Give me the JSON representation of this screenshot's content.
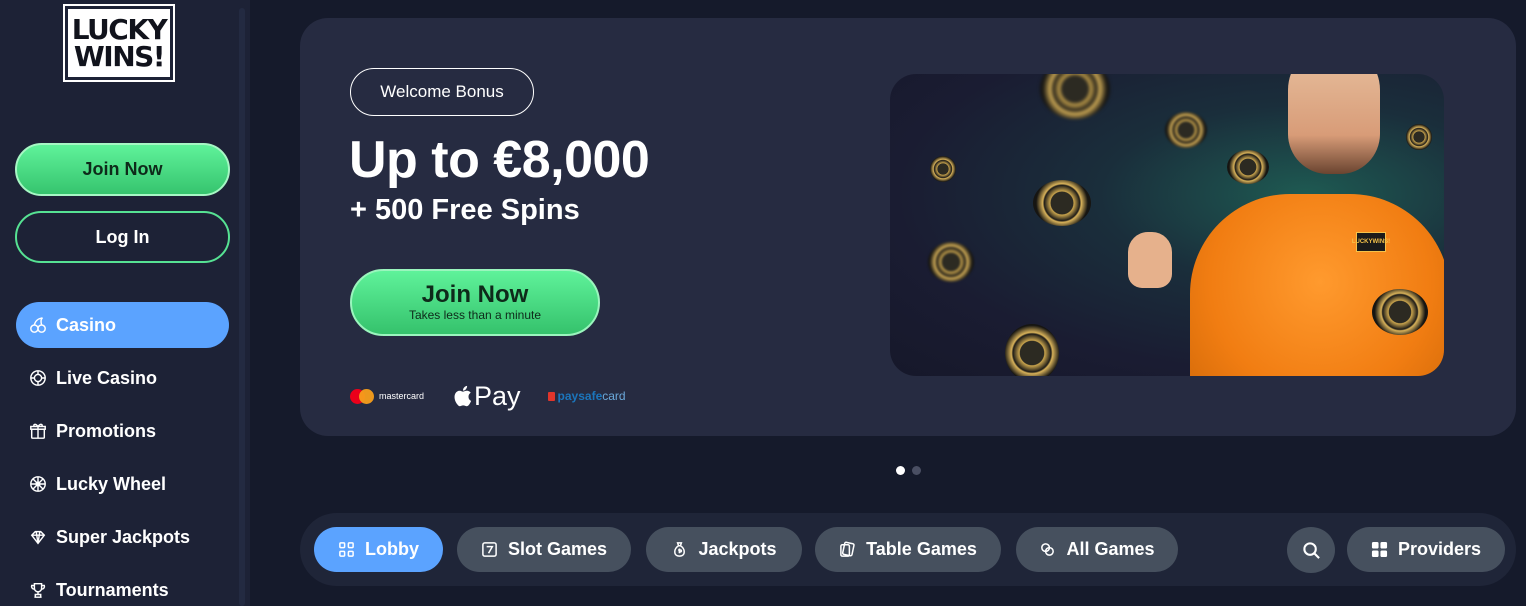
{
  "logo": {
    "line1": "LUCKY",
    "line2": "WINS!"
  },
  "auth": {
    "join_label": "Join Now",
    "login_label": "Log In"
  },
  "sidebar": {
    "items": [
      {
        "label": "Casino",
        "icon": "cherries-icon",
        "active": true
      },
      {
        "label": "Live Casino",
        "icon": "poker-chip-icon",
        "active": false
      },
      {
        "label": "Promotions",
        "icon": "gift-icon",
        "active": false
      },
      {
        "label": "Lucky Wheel",
        "icon": "wheel-icon",
        "active": false
      },
      {
        "label": "Super Jackpots",
        "icon": "diamond-icon",
        "active": false
      },
      {
        "label": "Tournaments",
        "icon": "trophy-icon",
        "active": false
      }
    ]
  },
  "banner": {
    "badge": "Welcome Bonus",
    "headline": "Up to €8,000",
    "subheadline": "+ 500 Free Spins",
    "cta_label": "Join Now",
    "cta_sublabel": "Takes less than a minute",
    "payments": {
      "mastercard": "mastercard",
      "applepay": "Pay",
      "paysafe_main": "paysafe",
      "paysafe_suffix": "card"
    },
    "hero_logo": {
      "line1": "LUCKY",
      "line2": "WINS!"
    }
  },
  "carousel": {
    "active_index": 0,
    "count": 2
  },
  "categories": [
    {
      "label": "Lobby",
      "icon": "grid-icon",
      "active": true
    },
    {
      "label": "Slot Games",
      "icon": "seven-icon",
      "active": false
    },
    {
      "label": "Jackpots",
      "icon": "money-bag-icon",
      "active": false
    },
    {
      "label": "Table Games",
      "icon": "cards-icon",
      "active": false
    },
    {
      "label": "All Games",
      "icon": "chips-icon",
      "active": false
    }
  ],
  "providers_label": "Providers",
  "colors": {
    "accent_blue": "#5ba3ff",
    "accent_green": "#4ddd85",
    "background": "#151a2b",
    "sidebar": "#1d2236",
    "banner": "#262b41",
    "pill": "#46505e"
  }
}
